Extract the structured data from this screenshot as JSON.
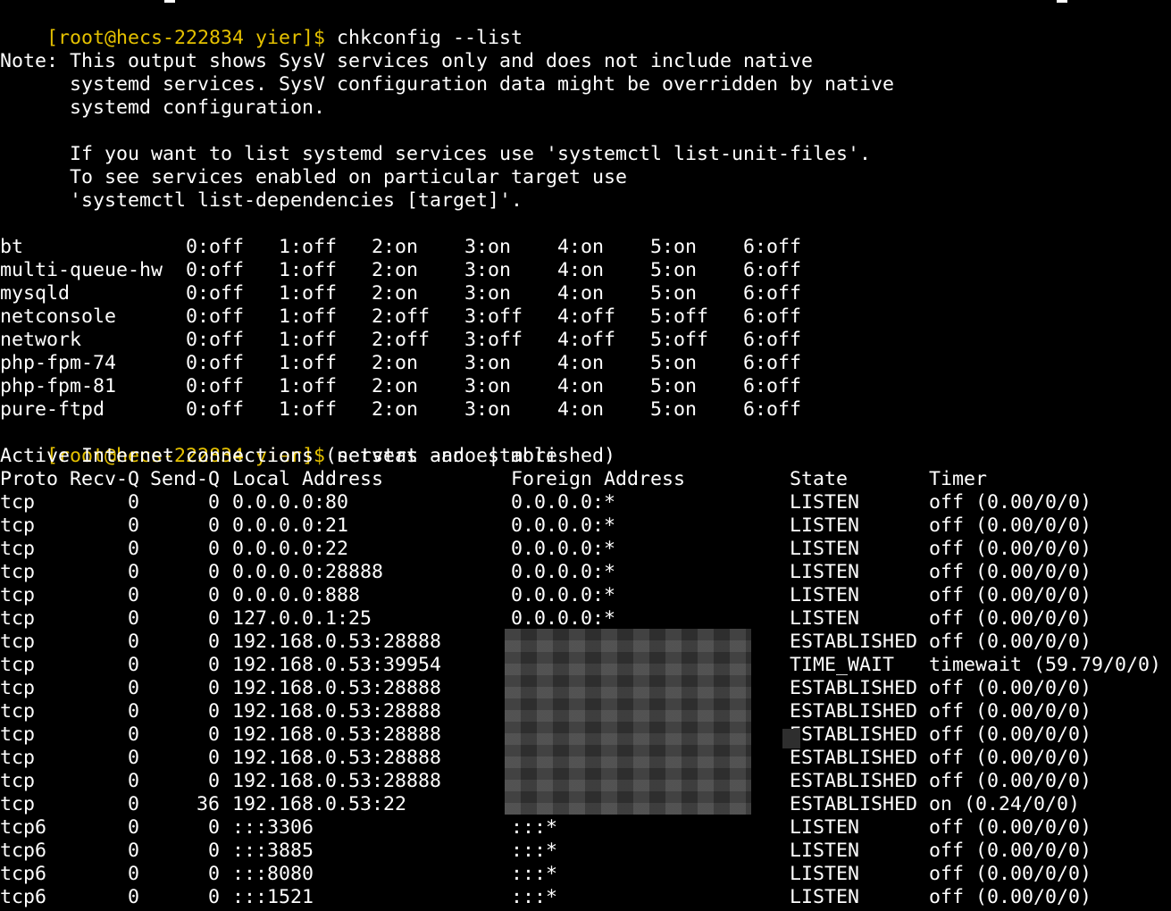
{
  "prompt": "[root@hecs-222834 yier]$",
  "commands": {
    "chkconfig": "chkconfig --list",
    "netstat": "netstat -ano | more"
  },
  "note": [
    "Note: This output shows SysV services only and does not include native",
    "      systemd services. SysV configuration data might be overridden by native",
    "      systemd configuration.",
    "",
    "      If you want to list systemd services use 'systemctl list-unit-files'.",
    "      To see services enabled on particular target use",
    "      'systemctl list-dependencies [target]'."
  ],
  "services": [
    {
      "name": "bt",
      "levels": [
        "0:off",
        "1:off",
        "2:on",
        "3:on",
        "4:on",
        "5:on",
        "6:off"
      ]
    },
    {
      "name": "multi-queue-hw",
      "levels": [
        "0:off",
        "1:off",
        "2:on",
        "3:on",
        "4:on",
        "5:on",
        "6:off"
      ]
    },
    {
      "name": "mysqld",
      "levels": [
        "0:off",
        "1:off",
        "2:on",
        "3:on",
        "4:on",
        "5:on",
        "6:off"
      ]
    },
    {
      "name": "netconsole",
      "levels": [
        "0:off",
        "1:off",
        "2:off",
        "3:off",
        "4:off",
        "5:off",
        "6:off"
      ]
    },
    {
      "name": "network",
      "levels": [
        "0:off",
        "1:off",
        "2:off",
        "3:off",
        "4:off",
        "5:off",
        "6:off"
      ]
    },
    {
      "name": "php-fpm-74",
      "levels": [
        "0:off",
        "1:off",
        "2:on",
        "3:on",
        "4:on",
        "5:on",
        "6:off"
      ]
    },
    {
      "name": "php-fpm-81",
      "levels": [
        "0:off",
        "1:off",
        "2:on",
        "3:on",
        "4:on",
        "5:on",
        "6:off"
      ]
    },
    {
      "name": "pure-ftpd",
      "levels": [
        "0:off",
        "1:off",
        "2:on",
        "3:on",
        "4:on",
        "5:on",
        "6:off"
      ]
    }
  ],
  "netstat_title": "Active Internet connections (servers and established)",
  "netstat_headers": {
    "proto": "Proto",
    "recvq": "Recv-Q",
    "sendq": "Send-Q",
    "local": "Local Address",
    "foreign": "Foreign Address",
    "state": "State",
    "timer": "Timer"
  },
  "connections": [
    {
      "proto": "tcp",
      "recvq": "0",
      "sendq": "0",
      "local": "0.0.0.0:80",
      "foreign": "0.0.0.0:*",
      "state": "LISTEN",
      "timer": "off (0.00/0/0)"
    },
    {
      "proto": "tcp",
      "recvq": "0",
      "sendq": "0",
      "local": "0.0.0.0:21",
      "foreign": "0.0.0.0:*",
      "state": "LISTEN",
      "timer": "off (0.00/0/0)"
    },
    {
      "proto": "tcp",
      "recvq": "0",
      "sendq": "0",
      "local": "0.0.0.0:22",
      "foreign": "0.0.0.0:*",
      "state": "LISTEN",
      "timer": "off (0.00/0/0)"
    },
    {
      "proto": "tcp",
      "recvq": "0",
      "sendq": "0",
      "local": "0.0.0.0:28888",
      "foreign": "0.0.0.0:*",
      "state": "LISTEN",
      "timer": "off (0.00/0/0)"
    },
    {
      "proto": "tcp",
      "recvq": "0",
      "sendq": "0",
      "local": "0.0.0.0:888",
      "foreign": "0.0.0.0:*",
      "state": "LISTEN",
      "timer": "off (0.00/0/0)"
    },
    {
      "proto": "tcp",
      "recvq": "0",
      "sendq": "0",
      "local": "127.0.0.1:25",
      "foreign": "0.0.0.0:*",
      "state": "LISTEN",
      "timer": "off (0.00/0/0)"
    },
    {
      "proto": "tcp",
      "recvq": "0",
      "sendq": "0",
      "local": "192.168.0.53:28888",
      "foreign": "",
      "state": "ESTABLISHED",
      "timer": "off (0.00/0/0)"
    },
    {
      "proto": "tcp",
      "recvq": "0",
      "sendq": "0",
      "local": "192.168.0.53:39954",
      "foreign": "",
      "state": "TIME_WAIT",
      "timer": "timewait (59.79/0/0)"
    },
    {
      "proto": "tcp",
      "recvq": "0",
      "sendq": "0",
      "local": "192.168.0.53:28888",
      "foreign": "",
      "state": "ESTABLISHED",
      "timer": "off (0.00/0/0)"
    },
    {
      "proto": "tcp",
      "recvq": "0",
      "sendq": "0",
      "local": "192.168.0.53:28888",
      "foreign": "",
      "state": "ESTABLISHED",
      "timer": "off (0.00/0/0)"
    },
    {
      "proto": "tcp",
      "recvq": "0",
      "sendq": "0",
      "local": "192.168.0.53:28888",
      "foreign": "",
      "state": "ESTABLISHED",
      "timer": "off (0.00/0/0)"
    },
    {
      "proto": "tcp",
      "recvq": "0",
      "sendq": "0",
      "local": "192.168.0.53:28888",
      "foreign": "",
      "state": "ESTABLISHED",
      "timer": "off (0.00/0/0)"
    },
    {
      "proto": "tcp",
      "recvq": "0",
      "sendq": "0",
      "local": "192.168.0.53:28888",
      "foreign": "",
      "state": "ESTABLISHED",
      "timer": "off (0.00/0/0)"
    },
    {
      "proto": "tcp",
      "recvq": "0",
      "sendq": "36",
      "local": "192.168.0.53:22",
      "foreign": "",
      "state": "ESTABLISHED",
      "timer": "on (0.24/0/0)"
    },
    {
      "proto": "tcp6",
      "recvq": "0",
      "sendq": "0",
      "local": ":::3306",
      "foreign": ":::*",
      "state": "LISTEN",
      "timer": "off (0.00/0/0)"
    },
    {
      "proto": "tcp6",
      "recvq": "0",
      "sendq": "0",
      "local": ":::3885",
      "foreign": ":::*",
      "state": "LISTEN",
      "timer": "off (0.00/0/0)"
    },
    {
      "proto": "tcp6",
      "recvq": "0",
      "sendq": "0",
      "local": ":::8080",
      "foreign": ":::*",
      "state": "LISTEN",
      "timer": "off (0.00/0/0)"
    },
    {
      "proto": "tcp6",
      "recvq": "0",
      "sendq": "0",
      "local": ":::1521",
      "foreign": ":::*",
      "state": "LISTEN",
      "timer": "off (0.00/0/0)"
    }
  ],
  "colors": {
    "background": "#000000",
    "foreground": "#ffffff",
    "prompt": "#e5c100"
  }
}
